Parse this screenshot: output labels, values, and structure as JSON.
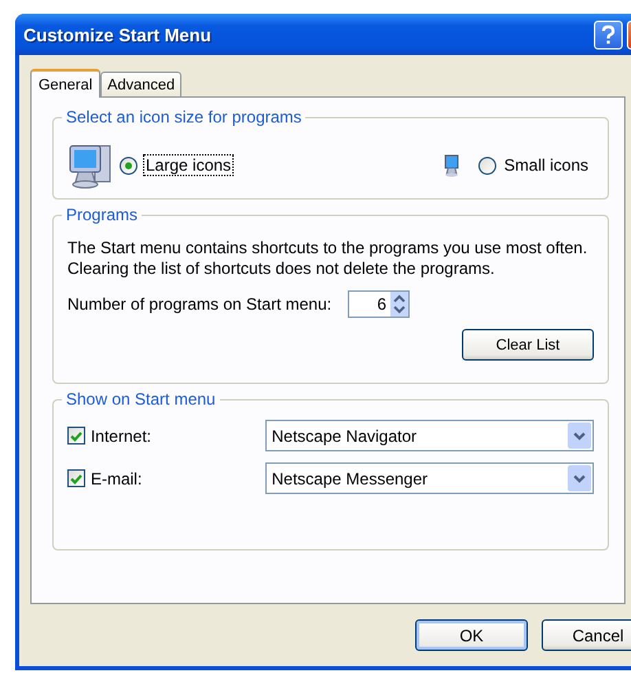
{
  "window": {
    "title": "Customize Start Menu"
  },
  "tabs": [
    {
      "label": "General",
      "selected": true
    },
    {
      "label": "Advanced",
      "selected": false
    }
  ],
  "icon_size": {
    "legend": "Select an icon size for programs",
    "options": [
      {
        "label": "Large icons",
        "kind": "large",
        "selected": true
      },
      {
        "label": "Small icons",
        "kind": "small",
        "selected": false
      }
    ]
  },
  "programs": {
    "legend": "Programs",
    "description_lines": [
      "The Start menu contains shortcuts to the programs you use most often.",
      "Clearing the list of shortcuts does not delete the programs."
    ],
    "count_label": "Number of programs on Start menu:",
    "count_value": "6",
    "clear_button": "Clear List"
  },
  "show_on_start_menu": {
    "legend": "Show on Start menu",
    "items": [
      {
        "label": "Internet:",
        "checked": true,
        "value": "Netscape Navigator"
      },
      {
        "label": "E-mail:",
        "checked": true,
        "value": "Netscape Messenger"
      }
    ]
  },
  "buttons": [
    {
      "label": "OK",
      "default": true
    },
    {
      "label": "Cancel",
      "default": false
    }
  ]
}
